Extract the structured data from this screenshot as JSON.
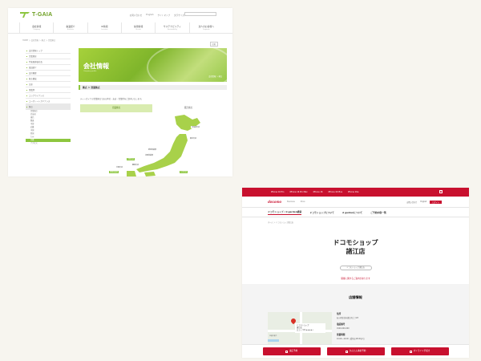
{
  "tgaia": {
    "logo_text": "T-GAIA",
    "util_links": [
      "お問い合わせ",
      "English",
      "サイトマップ",
      "文字サイズ"
    ],
    "nav": [
      {
        "label": "会社情報",
        "sub": "Company"
      },
      {
        "label": "事業紹介",
        "sub": "Business"
      },
      {
        "label": "IR情報",
        "sub": "Investors"
      },
      {
        "label": "採用情報",
        "sub": "Recruit"
      },
      {
        "label": "サステナビリティ",
        "sub": "Sustainability"
      },
      {
        "label": "法人のお客様へ",
        "sub": "Corporate"
      }
    ],
    "breadcrumb": "HOME ＞ 会社情報 ＞ 拠点 ＞ 営業拠点",
    "print_label": "印刷",
    "sidebar": [
      "会社情報トップ",
      "企業理念",
      "代表取締役社長",
      "役員紹介",
      "会社概要",
      "株主構成",
      "沿革",
      "事業所",
      "コンプライアンス",
      "コーポレートガバナンス",
      "拠点"
    ],
    "sidebar_sub": [
      "営業拠点",
      "北海道",
      "東北",
      "関東",
      "中部",
      "近畿",
      "中国",
      "四国",
      "九州",
      "沖縄",
      "アクセス"
    ],
    "banner": {
      "title": "会社情報",
      "en_title": "Company profile",
      "tag": "会社情報 ＞ 拠点"
    },
    "section_heading": "拠点 ＞ 営業拠点",
    "description": "ティーガイアの営業拠点である本社・支店・営業所をご案内いたします。",
    "tabs": [
      "営業拠点",
      "販売拠点"
    ],
    "map_labels": [
      "北海道支店",
      "東北支店",
      "新潟営業所",
      "北陸営業所",
      "中部支店",
      "関西支店",
      "中国支店",
      "四国営業所",
      "九州支店"
    ]
  },
  "docomo": {
    "promo_links": [
      "iPhone 16 Pro",
      "iPhone 16 Pro Max",
      "iPhone 16",
      "iPhone 16 Plus",
      "iPhone 16e"
    ],
    "close_icon_label": "×",
    "logo_text": "docomo",
    "header_links": [
      "Business",
      "Store"
    ],
    "header_right": [
      "お問い合わせ",
      "English",
      "ログイン"
    ],
    "gnav": [
      "ドコモショップ / d garden検索",
      "ドコモショップについて",
      "d gardenについて",
      "ご予約内容一覧"
    ],
    "breadcrumb": "ホーム ＞ ドコモショップ諸江店",
    "shop_name_line1": "ドコモショップ",
    "shop_name_line2": "諸江店",
    "pill_label": "ドコモショップ 諸江店",
    "pill_link": "開催に関するご案内があります",
    "info_title": "店舗情報",
    "map": {
      "card_title": "ドコモショップ",
      "card_sub": "諸江店",
      "card_meta": "口コミ 3.8 ★★★★☆",
      "labels": [
        "北陸大通り",
        "諸江町",
        "浅野川"
      ]
    },
    "details": [
      {
        "label": "住所",
        "value": "石川県金沢市諸江町上丁28"
      },
      {
        "label": "電話番号",
        "value": "0120-000-000"
      },
      {
        "label": "営業時間",
        "value": "10:00〜19:00（受付は18:00まで）"
      }
    ],
    "footer_buttons": [
      "来店予約",
      "かんたん事前予約",
      "オンライン手続き"
    ]
  }
}
